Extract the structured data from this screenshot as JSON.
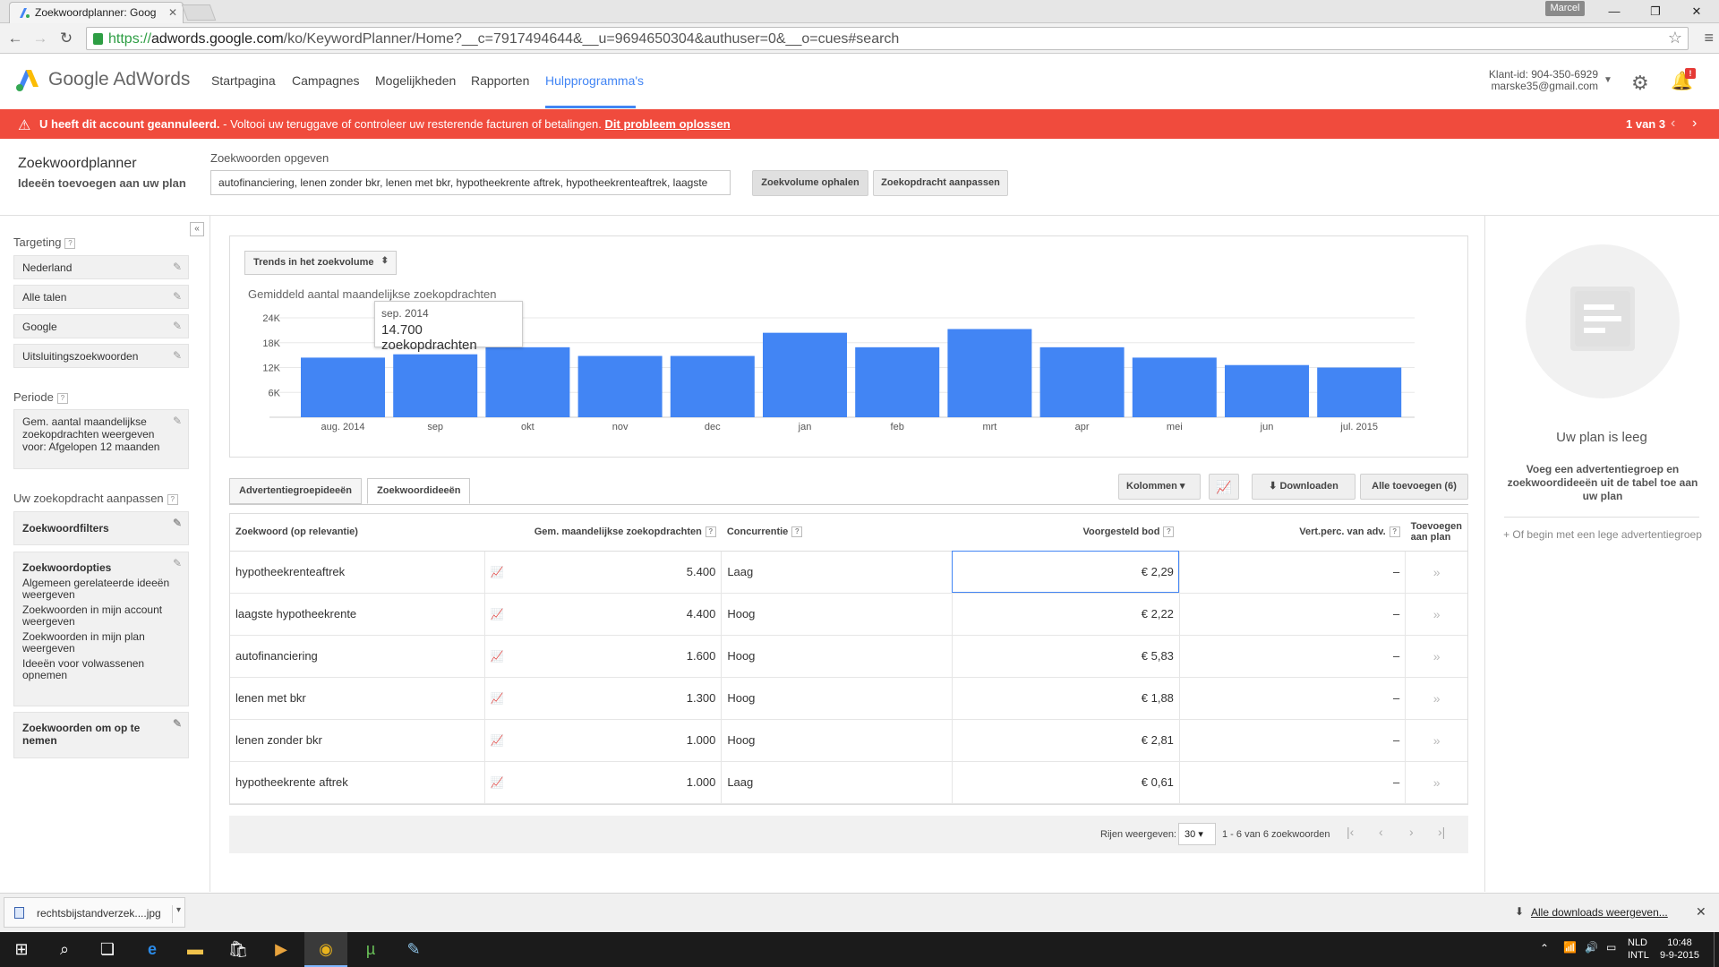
{
  "browser": {
    "tab_title": "Zoekwoordplanner: Goog",
    "profile_name": "Marcel",
    "url_scheme": "https://",
    "url_host": "adwords.google.com",
    "url_path": "/ko/KeywordPlanner/Home?__c=7917494644&__u=9694650304&authuser=0&__o=cues#search"
  },
  "header": {
    "logo_text": "Google AdWords",
    "nav": [
      "Startpagina",
      "Campagnes",
      "Mogelijkheden",
      "Rapporten",
      "Hulpprogramma's"
    ],
    "active_nav": "Hulpprogramma's",
    "client_id": "Klant-id: 904-350-6929",
    "email": "marske35@gmail.com",
    "notification_badge": "!"
  },
  "alert": {
    "bold_text": "U heeft dit account geannuleerd.",
    "text": " - Voltooi uw teruggave of controleer uw resterende facturen of betalingen. ",
    "link": "Dit probleem oplossen",
    "count": "1 van 3",
    "color": "#f04b3d"
  },
  "planner": {
    "title": "Zoekwoordplanner",
    "subtitle": "Ideeën toevoegen aan uw plan",
    "keywords_label": "Zoekwoorden opgeven",
    "keywords_value": "autofinanciering,  lenen zonder bkr,  lenen met bkr,  hypotheekrente aftrek, hypotheekrenteaftrek,  laagste",
    "btn_volume": "Zoekvolume ophalen",
    "btn_adjust": "Zoekopdracht aanpassen"
  },
  "sidebar": {
    "targeting_label": "Targeting",
    "targeting_items": [
      "Nederland",
      "Alle talen",
      "Google",
      "Uitsluitingszoekwoorden"
    ],
    "period_label": "Periode",
    "period_text": "Gem. aantal maandelijkse zoekopdrachten weergeven voor: Afgelopen 12 maanden",
    "adjust_label": "Uw zoekopdracht aanpassen",
    "filters_label": "Zoekwoordfilters",
    "options_label": "Zoekwoordopties",
    "options": [
      "Algemeen gerelateerde ideeën weergeven",
      "Zoekwoorden in mijn account weergeven",
      "Zoekwoorden in mijn plan weergeven",
      "Ideeën voor volwassenen opnemen"
    ],
    "include_label": "Zoekwoorden om op te nemen"
  },
  "chart_data": {
    "type": "bar",
    "select_label": "Trends in het zoekvolume",
    "title": "Gemiddeld aantal maandelijkse zoekopdrachten",
    "categories": [
      "aug. 2014",
      "sep",
      "okt",
      "nov",
      "dec",
      "jan",
      "feb",
      "mrt",
      "apr",
      "mei",
      "jun",
      "jul. 2015"
    ],
    "values": [
      14400,
      15200,
      16900,
      14800,
      14800,
      20400,
      16900,
      21300,
      16900,
      14400,
      12600,
      12000
    ],
    "y_ticks": [
      "6K",
      "12K",
      "18K",
      "24K"
    ],
    "ylim": [
      0,
      24000
    ],
    "bar_color": "#4285f4",
    "tooltip": {
      "date": "sep. 2014",
      "value": "14.700 zoekopdrachten"
    }
  },
  "results": {
    "tab_adgroup": "Advertentiegroepideeën",
    "tab_keywords": "Zoekwoordideeën",
    "btn_columns": "Kolommen",
    "btn_download": "Downloaden",
    "btn_add_all": "Alle toevoegen (6)",
    "columns": {
      "keyword": "Zoekwoord (op relevantie)",
      "volume": "Gem. maandelijkse zoekopdrachten",
      "competition": "Concurrentie",
      "bid": "Voorgesteld bod",
      "ad_share": "Vert.perc. van adv.",
      "add": "Toevoegen aan plan"
    },
    "rows": [
      {
        "keyword": "hypotheekrenteaftrek",
        "volume": "5.400",
        "competition": "Laag",
        "bid": "€ 2,29",
        "ad_share": "–",
        "add": "»"
      },
      {
        "keyword": "laagste hypotheekrente",
        "volume": "4.400",
        "competition": "Hoog",
        "bid": "€ 2,22",
        "ad_share": "–",
        "add": "»"
      },
      {
        "keyword": "autofinanciering",
        "volume": "1.600",
        "competition": "Hoog",
        "bid": "€ 5,83",
        "ad_share": "–",
        "add": "»"
      },
      {
        "keyword": "lenen met bkr",
        "volume": "1.300",
        "competition": "Hoog",
        "bid": "€ 1,88",
        "ad_share": "–",
        "add": "»"
      },
      {
        "keyword": "lenen zonder bkr",
        "volume": "1.000",
        "competition": "Hoog",
        "bid": "€ 2,81",
        "ad_share": "–",
        "add": "»"
      },
      {
        "keyword": "hypotheekrente aftrek",
        "volume": "1.000",
        "competition": "Laag",
        "bid": "€ 0,61",
        "ad_share": "–",
        "add": "»"
      }
    ],
    "rows_label": "Rijen weergeven:",
    "rows_value": "30",
    "range_text": "1 - 6 van 6 zoekwoorden"
  },
  "plan": {
    "empty_title": "Uw plan is leeg",
    "description": "Voeg een advertentiegroep en zoekwoordideeën uit de tabel toe aan uw plan",
    "new_group": "+ Of begin met een lege advertentiegroep"
  },
  "downloads": {
    "file": "rechtsbijstandverzek....jpg",
    "show_all": "Alle downloads weergeven..."
  },
  "taskbar": {
    "lang_top": "NLD",
    "lang_bottom": "INTL",
    "time": "10:48",
    "date": "9-9-2015"
  }
}
